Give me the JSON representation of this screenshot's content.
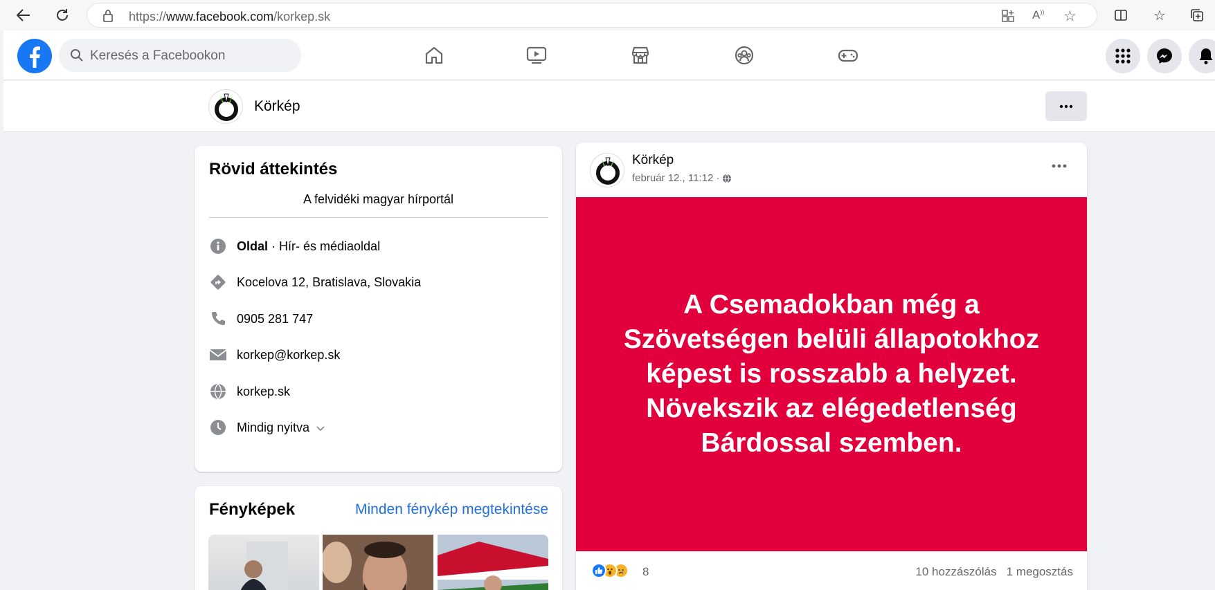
{
  "browser": {
    "url_prefix": "https://",
    "url_host": "www.facebook.com",
    "url_path": "/korkep.sk"
  },
  "fb_nav": {
    "search_placeholder": "Keresés a Facebookon"
  },
  "page_header": {
    "name": "Körkép"
  },
  "intro": {
    "title": "Rövid áttekintés",
    "description": "A felvidéki magyar hírportál",
    "page_type_bold": "Oldal",
    "page_type_rest": " · Hír- és médiaoldal",
    "address": "Kocelova 12, Bratislava, Slovakia",
    "phone": "0905 281 747",
    "email": "korkep@korkep.sk",
    "website": "korkep.sk",
    "hours": "Mindig nyitva"
  },
  "photos": {
    "title": "Fényképek",
    "see_all": "Minden fénykép megtekintése"
  },
  "post": {
    "author": "Körkép",
    "time": "február 12., 11:12 ·",
    "banner_text": "A Csemadokban még a Szövetségen belüli állapotokhoz képest is rosszabb a helyzet. Növekszik az elégedetlenség Bárdossal szemben.",
    "reaction_count": "8",
    "comments": "10 hozzászólás",
    "shares": "1 megosztás"
  },
  "colors": {
    "fb_blue": "#1877f2",
    "banner_red": "#e1003b",
    "link_blue": "#216fdb",
    "open_green": "#31a24c"
  }
}
